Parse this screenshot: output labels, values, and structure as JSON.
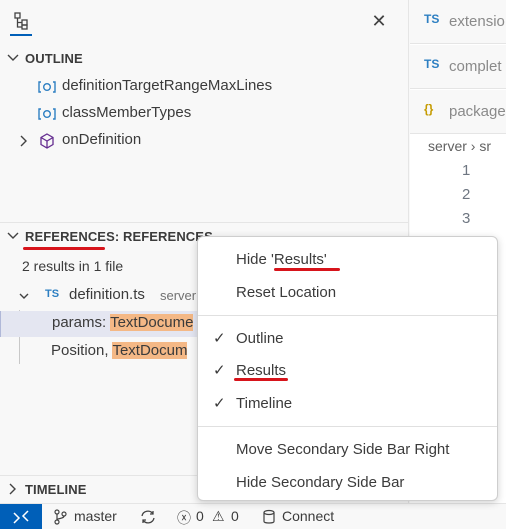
{
  "sidebar": {
    "outline": {
      "title": "OUTLINE",
      "items": [
        {
          "label": "definitionTargetRangeMaxLines",
          "icon": "field-icon"
        },
        {
          "label": "classMemberTypes",
          "icon": "field-icon"
        },
        {
          "label": "onDefinition",
          "icon": "method-icon"
        }
      ]
    },
    "references": {
      "title": "REFERENCES: REFERENCES",
      "summary": "2 results in 1 file",
      "file": {
        "badge": "TS",
        "name": "definition.ts",
        "path": "server"
      },
      "results": [
        {
          "prefix": "params: ",
          "match": "TextDocume"
        },
        {
          "prefix": "Position, ",
          "match": "TextDocum"
        }
      ]
    },
    "timeline": {
      "title": "TIMELINE"
    }
  },
  "editor": {
    "tabs": [
      {
        "badge": "TS",
        "label": "extensio"
      },
      {
        "badge": "TS",
        "label": "complet"
      },
      {
        "badge": "{}",
        "label": "package"
      }
    ],
    "breadcrumb": {
      "first": "server",
      "second": "sr"
    },
    "line_numbers": [
      "1",
      "2",
      "3"
    ]
  },
  "statusbar": {
    "branch": "master",
    "errors": "0",
    "warnings": "0",
    "connect": "Connect"
  },
  "context_menu": {
    "hide_results": "Hide 'Results'",
    "reset_location": "Reset Location",
    "outline": "Outline",
    "results": "Results",
    "timeline": "Timeline",
    "move_right": "Move Secondary Side Bar Right",
    "hide_secondary": "Hide Secondary Side Bar"
  },
  "colors": {
    "accent": "#005fb8",
    "highlight": "#f4b886",
    "annotation": "#d7141b"
  }
}
